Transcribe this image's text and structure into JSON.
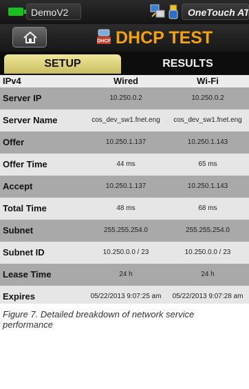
{
  "status_bar": {
    "profile_name": "DemoV2",
    "device_name": "OneTouch AT",
    "battery_color": "#19c11e",
    "icons": [
      "battery-icon",
      "network-icon",
      "usb-icon"
    ]
  },
  "title_bar": {
    "title": "DHCP TEST",
    "title_color": "#f6a20c",
    "dhcp_icon_text": "DHCP",
    "icons": [
      "home-icon",
      "dhcp-icon"
    ]
  },
  "tabs": [
    {
      "label": "SETUP",
      "active": true
    },
    {
      "label": "RESULTS",
      "active": false
    }
  ],
  "table": {
    "headers": [
      "IPv4",
      "Wired",
      "Wi-Fi"
    ],
    "rows": [
      {
        "label": "Server IP",
        "wired": "10.250.0.2",
        "wifi": "10.250.0.2"
      },
      {
        "label": "Server Name",
        "wired": "cos_dev_sw1.fnet.eng",
        "wifi": "cos_dev_sw1.fnet.eng"
      },
      {
        "label": "Offer",
        "wired": "10.250.1.137",
        "wifi": "10.250.1.143"
      },
      {
        "label": "Offer Time",
        "wired": "44 ms",
        "wifi": "65 ms"
      },
      {
        "label": "Accept",
        "wired": "10.250.1.137",
        "wifi": "10.250.1.143"
      },
      {
        "label": "Total Time",
        "wired": "48 ms",
        "wifi": "68 ms"
      },
      {
        "label": "Subnet",
        "wired": "255.255.254.0",
        "wifi": "255.255.254.0"
      },
      {
        "label": "Subnet ID",
        "wired": "10.250.0.0 / 23",
        "wifi": "10.250.0.0 / 23"
      },
      {
        "label": "Lease Time",
        "wired": "24 h",
        "wifi": "24 h"
      },
      {
        "label": "Expires",
        "wired": "05/22/2013 9:07:25 am",
        "wifi": "05/22/2013 9:07:28 am"
      }
    ]
  },
  "caption": "Figure 7. Detailed breakdown of network service performance"
}
